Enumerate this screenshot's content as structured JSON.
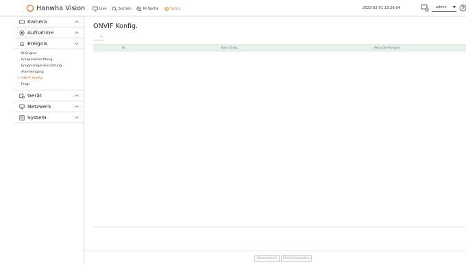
{
  "brand": {
    "name": "Hanwha Vision"
  },
  "topnav": {
    "items": [
      {
        "label": "Live",
        "icon": "monitor-icon"
      },
      {
        "label": "Suchen",
        "icon": "search-icon"
      },
      {
        "label": "KI-Suche",
        "icon": "ai-search-icon"
      },
      {
        "label": "Setup",
        "icon": "gear-icon",
        "active": true
      }
    ],
    "datetime": "2023-02-01 13:28:04",
    "user": "admin"
  },
  "sidebar": {
    "menus": [
      {
        "label": "Kamera",
        "icon": "camera-icon",
        "expanded": false
      },
      {
        "label": "Aufnahme",
        "icon": "record-icon",
        "expanded": false
      },
      {
        "label": "Ereignis",
        "icon": "bell-icon",
        "expanded": true,
        "items": [
          {
            "label": "KI-Engine"
          },
          {
            "label": "Ereigniseinrichtung"
          },
          {
            "label": "Ereignisregel-Einrichtung"
          },
          {
            "label": "Alarmeingang"
          },
          {
            "label": "ONVIF Konfig.",
            "active": true,
            "marker": ">"
          },
          {
            "label": "Progr."
          }
        ]
      },
      {
        "label": "Gerät",
        "icon": "device-icon",
        "expanded": false
      },
      {
        "label": "Netzwerk",
        "icon": "network-icon",
        "expanded": false
      },
      {
        "label": "System",
        "icon": "system-icon",
        "expanded": false
      }
    ]
  },
  "main": {
    "title": "ONVIF Konfig.",
    "page_size": "",
    "table": {
      "columns": [
        "Nr",
        "Kam. Ereig.",
        "Recorder-Ereignis"
      ],
      "rows": []
    },
    "buttons": {
      "apply": "Übernehmen",
      "reset": "Wiederherstellen"
    }
  },
  "colors": {
    "accent": "#f37321",
    "table_header_bg": "#e8f1ea"
  }
}
